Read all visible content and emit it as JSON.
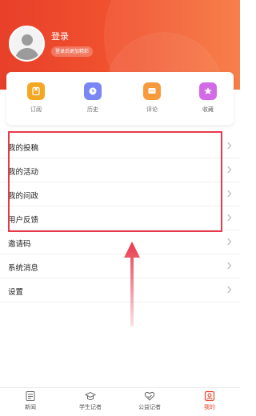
{
  "header": {
    "login_title": "登录",
    "login_badge": "登录后更加精彩"
  },
  "quick_actions": [
    {
      "label": "订阅",
      "icon": "subscribe-icon",
      "color": "#f5a623"
    },
    {
      "label": "历史",
      "icon": "history-icon",
      "color": "#7b86f5"
    },
    {
      "label": "评论",
      "icon": "comment-icon",
      "color": "#f79a3e"
    },
    {
      "label": "收藏",
      "icon": "favorite-icon",
      "color": "#d36be8"
    }
  ],
  "menu": [
    {
      "label": "我的投稿"
    },
    {
      "label": "我的活动"
    },
    {
      "label": "我的问政"
    },
    {
      "label": "用户反馈"
    },
    {
      "label": "邀请码"
    },
    {
      "label": "系统消息"
    },
    {
      "label": "设置"
    }
  ],
  "tabbar": {
    "tabs": [
      {
        "label": "新闻",
        "icon": "news-icon"
      },
      {
        "label": "学生记者",
        "icon": "student-reporter-icon"
      },
      {
        "label": "公益记者",
        "icon": "charity-reporter-icon"
      },
      {
        "label": "我的",
        "icon": "profile-icon",
        "active": true
      }
    ],
    "active_color": "#e8402a"
  },
  "annotation": {
    "box_color": "#e8394b"
  }
}
